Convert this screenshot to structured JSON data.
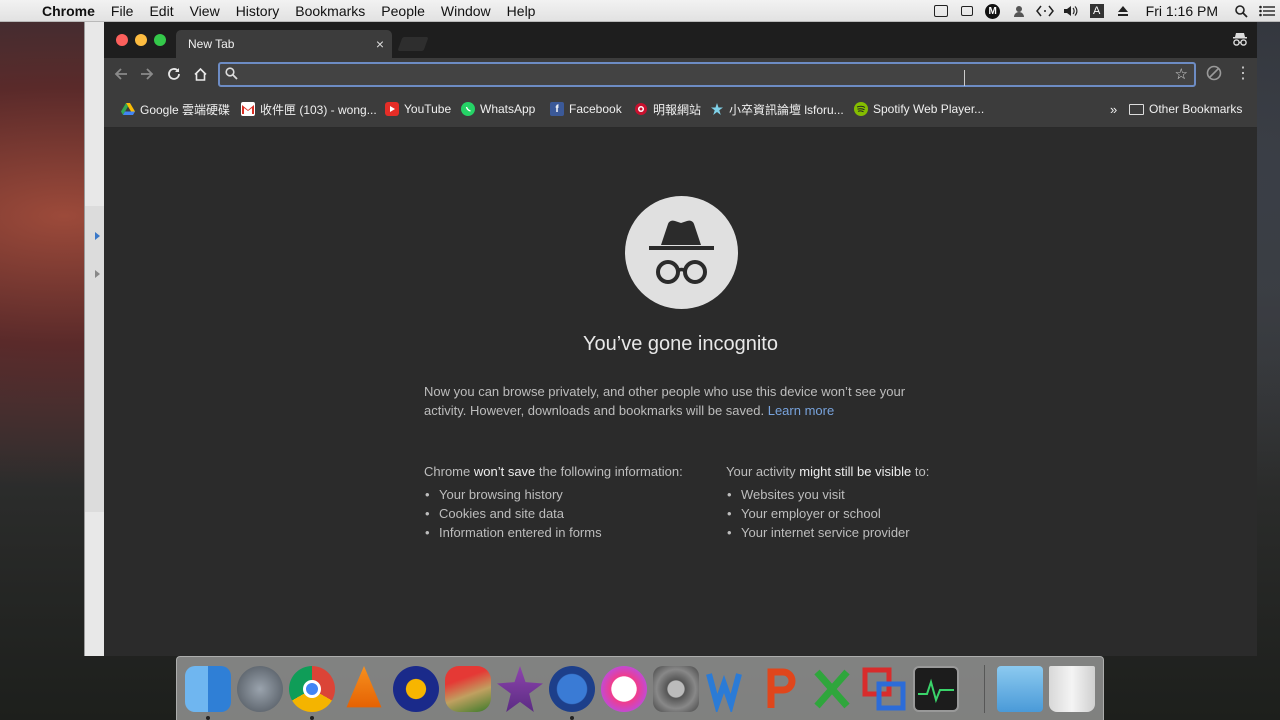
{
  "menubar": {
    "app": "Chrome",
    "menus": [
      "File",
      "Edit",
      "View",
      "History",
      "Bookmarks",
      "People",
      "Window",
      "Help"
    ],
    "clock": "Fri 1:16 PM",
    "status_icons": [
      "facetime-icon",
      "screen-mirror-icon",
      "malwarebytes-icon",
      "user-icon",
      "code-icon",
      "volume-icon",
      "input-source-icon",
      "eject-icon",
      "spotlight-search-icon",
      "notification-center-icon"
    ],
    "input_source_letter": "A",
    "m_letter": "M"
  },
  "tab": {
    "title": "New Tab",
    "close": "×"
  },
  "toolbar": {
    "omnibox_value": "",
    "omnibox_placeholder": ""
  },
  "bookmarks": {
    "items": [
      {
        "label": "Google 雲端硬碟",
        "icon": "google-drive-icon"
      },
      {
        "label": "收件匣 (103) - wong...",
        "icon": "gmail-icon"
      },
      {
        "label": "YouTube",
        "icon": "youtube-icon"
      },
      {
        "label": "WhatsApp",
        "icon": "whatsapp-icon"
      },
      {
        "label": "Facebook",
        "icon": "facebook-icon"
      },
      {
        "label": "明報網站",
        "icon": "mingpao-icon"
      },
      {
        "label": "小卒資訊論壇 lsforu...",
        "icon": "forum-icon"
      },
      {
        "label": "Spotify Web Player...",
        "icon": "spotify-icon"
      }
    ],
    "overflow": "»",
    "other": "Other Bookmarks"
  },
  "incognito": {
    "heading": "You’ve gone incognito",
    "intro": "Now you can browse privately, and other people who use this device won’t see your activity. However, downloads and bookmarks will be saved.",
    "learn_more": "Learn more",
    "left": {
      "pre": "Chrome ",
      "bold": "won’t save",
      "post": " the following information:",
      "items": [
        "Your browsing history",
        "Cookies and site data",
        "Information entered in forms"
      ]
    },
    "right": {
      "pre": "Your activity ",
      "bold": "might still be visible",
      "post": " to:",
      "items": [
        "Websites you visit",
        "Your employer or school",
        "Your internet service provider"
      ]
    }
  },
  "dock": {
    "apps": [
      "finder-icon",
      "launchpad-icon",
      "chrome-icon",
      "vlc-icon",
      "audacity-icon",
      "cocktail-icon",
      "imovie-icon",
      "photo-booth-icon",
      "itunes-icon",
      "system-preferences-icon",
      "word-icon",
      "powerpoint-icon",
      "excel-icon",
      "parallels-icon",
      "activity-monitor-icon",
      "downloads-folder-icon",
      "trash-icon"
    ]
  },
  "colors": {
    "chrome_bg": "#2b2b2b",
    "toolbar": "#3c3c3c",
    "link": "#78a3dc",
    "omnibox_focus": "#6d8cc4"
  }
}
